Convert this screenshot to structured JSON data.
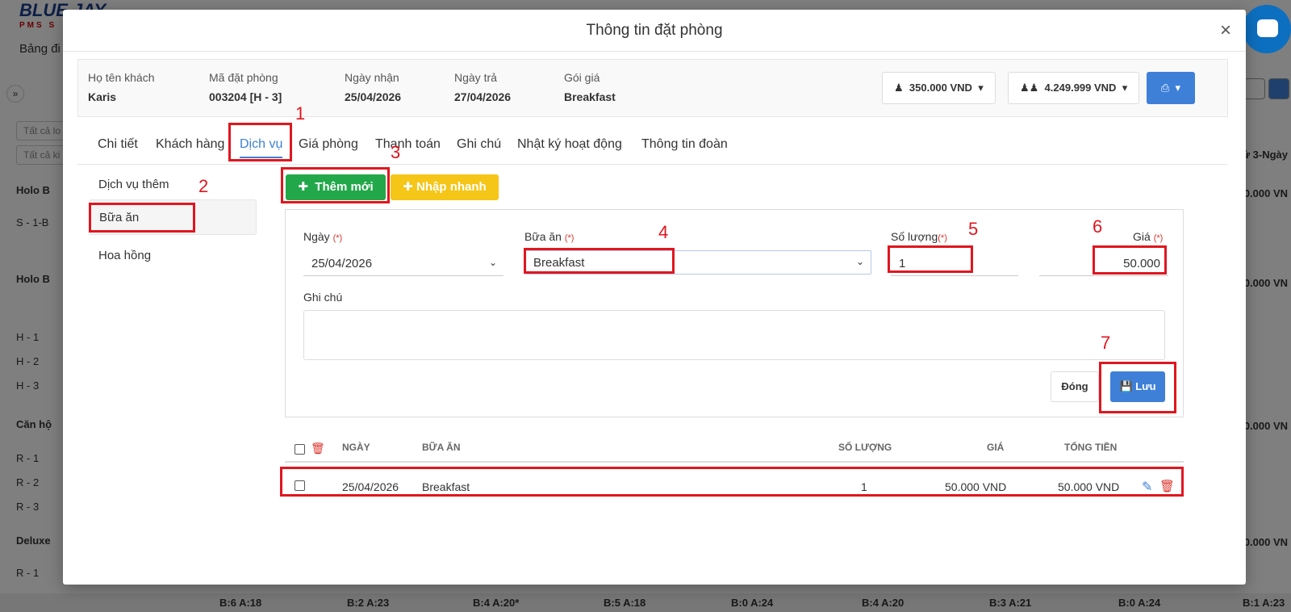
{
  "background": {
    "logo_text": "BLUE JAY",
    "logo_sub": "PMS S",
    "nav_label": "Bảng đi",
    "filter1": "Tất cả lo",
    "filter2": "Tất cả ki",
    "rows": [
      "Holo B",
      "S - 1-B",
      "Holo B",
      "H - 1",
      "H - 2",
      "H - 3",
      "Căn hộ",
      "R - 1",
      "R - 2",
      "R - 3",
      "Deluxe",
      "R - 1"
    ],
    "right_values": [
      "ứ 3-Ngày",
      "0.000 VN",
      "0.000 VN",
      "0.000 VN",
      "0.000 VN"
    ],
    "footer_cells": [
      "B:6 A:18",
      "B:2 A:23",
      "B:4 A:20*",
      "B:5 A:18",
      "B:0 A:24",
      "B:4 A:20",
      "B:3 A:21",
      "B:0 A:24",
      "B:1 A:23"
    ]
  },
  "modal": {
    "title": "Thông tin đặt phòng",
    "close_glyph": "×",
    "info": {
      "guest_label": "Họ tên khách",
      "guest_value": "Karis",
      "booking_label": "Mã đặt phòng",
      "booking_value": "003204 [H - 3]",
      "checkin_label": "Ngày nhận",
      "checkin_value": "25/04/2026",
      "checkout_label": "Ngày trả",
      "checkout_value": "27/04/2026",
      "package_label": "Gói giá",
      "package_value": "Breakfast",
      "price1": "350.000 VND",
      "price2": "4.249.999 VND"
    },
    "tabs": [
      "Chi tiết",
      "Khách hàng",
      "Dịch vụ",
      "Giá phòng",
      "Thanh toán",
      "Ghi chú",
      "Nhật ký hoạt động",
      "Thông tin đoàn"
    ],
    "side_menu": [
      "Dịch vụ thêm",
      "Bữa ăn",
      "Hoa hồng"
    ],
    "add_button": "Thêm mới",
    "quick_button": "Nhập nhanh",
    "form": {
      "date_label": "Ngày",
      "date_value": "25/04/2026",
      "meal_label": "Bữa ăn",
      "meal_value": "Breakfast",
      "qty_label": "Số lượng",
      "qty_value": "1",
      "price_label": "Giá",
      "price_value": "50.000",
      "required_mark": "(*)",
      "note_label": "Ghi chú",
      "close_button": "Đóng",
      "save_button": "Lưu"
    },
    "table": {
      "headers": [
        "NGÀY",
        "BỮA ĂN",
        "SỐ LƯỢNG",
        "GIÁ",
        "TỔNG TIỀN"
      ],
      "rows": [
        {
          "date": "25/04/2026",
          "meal": "Breakfast",
          "qty": "1",
          "price": "50.000 VND",
          "total": "50.000 VND"
        }
      ]
    }
  },
  "annotations": [
    "1",
    "2",
    "3",
    "4",
    "5",
    "6",
    "7"
  ]
}
